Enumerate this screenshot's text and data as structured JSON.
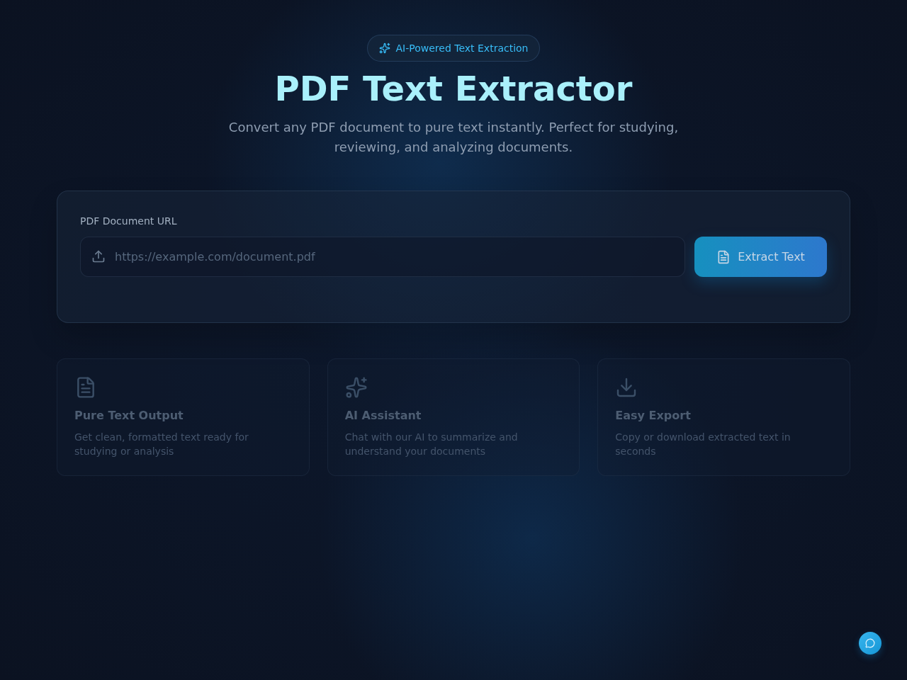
{
  "badge": {
    "text": "AI-Powered Text Extraction"
  },
  "header": {
    "title": "PDF Text Extractor",
    "subtitle": "Convert any PDF document to pure text instantly. Perfect for studying, reviewing, and analyzing documents."
  },
  "form": {
    "label": "PDF Document URL",
    "input": {
      "placeholder": "https://example.com/document.pdf"
    },
    "button": "Extract Text"
  },
  "features": [
    {
      "kind": "document",
      "title": "Pure Text Output",
      "description": "Get clean, formatted text ready for studying or analysis"
    },
    {
      "kind": "sparkles",
      "title": "AI Assistant",
      "description": "Chat with our AI to summarize and understand your documents"
    },
    {
      "kind": "download",
      "title": "Easy Export",
      "description": "Copy or download extracted text in seconds"
    }
  ]
}
